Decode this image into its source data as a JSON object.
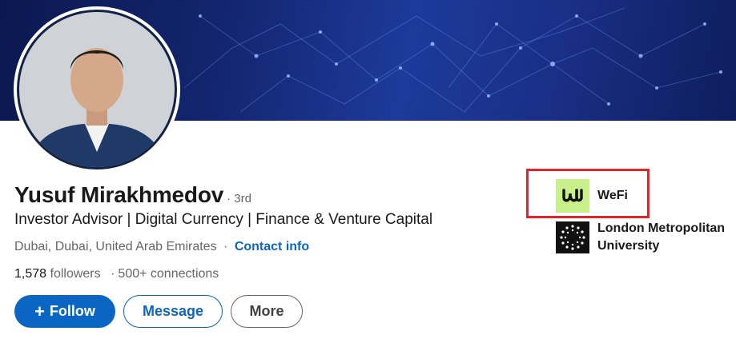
{
  "profile": {
    "name": "Yusuf Mirakhmedov",
    "degree": "· 3rd",
    "headline": "Investor Advisor | Digital Currency | Finance & Venture Capital",
    "location": "Dubai, Dubai, United Arab Emirates",
    "location_sep": "·",
    "contact_info": "Contact info",
    "followers_count": "1,578",
    "followers_label": "followers",
    "connections_sep": "·",
    "connections": "500+ connections"
  },
  "actions": {
    "follow_icon": "+",
    "follow_label": "Follow",
    "message_label": "Message",
    "more_label": "More"
  },
  "organizations": [
    {
      "name": "WeFi",
      "logo_text": "ω",
      "logo_color": "#c8f08a",
      "highlighted": true
    },
    {
      "name_line1": "London Metropolitan",
      "name_line2": "University",
      "logo_color": "#111111"
    }
  ],
  "colors": {
    "link": "#0a66c2",
    "highlight": "#e0242a",
    "banner": "#13256e"
  }
}
